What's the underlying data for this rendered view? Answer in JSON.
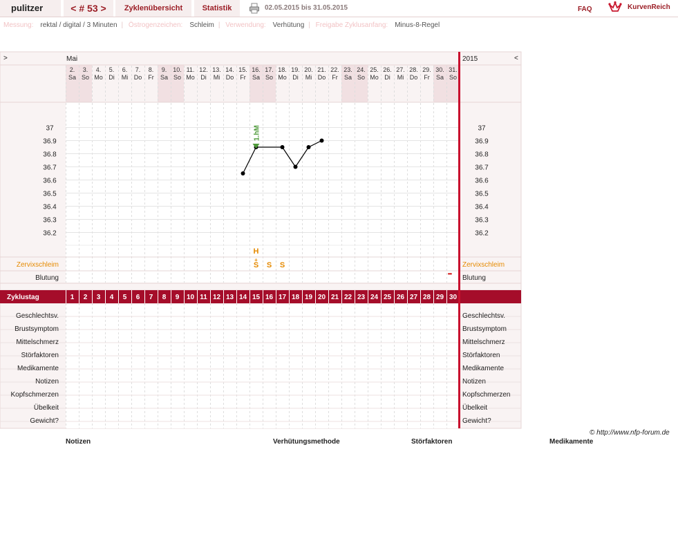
{
  "header": {
    "user": "pulitzer",
    "cycle_nav": "< # 53 >",
    "tab_overview": "Zyklenübersicht",
    "tab_stats": "Statistik",
    "date_range": "02.05.2015 bis 31.05.2015",
    "faq": "FAQ",
    "brand": "KurvenReich"
  },
  "settings": [
    {
      "label": "Messung:",
      "value": "rektal / digital / 3 Minuten"
    },
    {
      "label": "Östrogenzeichen:",
      "value": "Schleim"
    },
    {
      "label": "Verwendung:",
      "value": "Verhütung"
    },
    {
      "label": "Freigabe Zyklusanfang:",
      "value": "Minus-8-Regel"
    }
  ],
  "nav": {
    "left_arrow": ">",
    "right_arrow": "<",
    "month": "Mai",
    "year": "2015"
  },
  "chart_data": {
    "type": "line",
    "title": "",
    "dates": [
      "2.",
      "3.",
      "4.",
      "5.",
      "6.",
      "7.",
      "8.",
      "9.",
      "10.",
      "11.",
      "12.",
      "13.",
      "14.",
      "15.",
      "16.",
      "17.",
      "18.",
      "19.",
      "20.",
      "21.",
      "22.",
      "23.",
      "24.",
      "25.",
      "26.",
      "27.",
      "28.",
      "29.",
      "30.",
      "31."
    ],
    "weekdays": [
      "Sa",
      "So",
      "Mo",
      "Di",
      "Mi",
      "Do",
      "Fr",
      "Sa",
      "So",
      "Mo",
      "Di",
      "Mi",
      "Do",
      "Fr",
      "Sa",
      "So",
      "Mo",
      "Di",
      "Mi",
      "Do",
      "Fr",
      "Sa",
      "So",
      "Mo",
      "Di",
      "Mi",
      "Do",
      "Fr",
      "Sa",
      "So"
    ],
    "weekend_days": [
      1,
      2,
      8,
      9,
      15,
      16,
      22,
      23,
      29,
      30
    ],
    "cycle_days": [
      1,
      2,
      3,
      4,
      5,
      6,
      7,
      8,
      9,
      10,
      11,
      12,
      13,
      14,
      15,
      16,
      17,
      18,
      19,
      20,
      21,
      22,
      23,
      24,
      25,
      26,
      27,
      28,
      29,
      30
    ],
    "y_ticks": [
      "37",
      "36.9",
      "36.8",
      "36.7",
      "36.6",
      "36.5",
      "36.4",
      "36.3",
      "36.2"
    ],
    "ylim": [
      36.1,
      37.0
    ],
    "series": [
      {
        "points": [
          [
            14,
            36.65
          ],
          [
            15,
            36.85
          ],
          [
            17,
            36.85
          ],
          [
            18,
            36.7
          ],
          [
            19,
            36.85
          ],
          [
            20,
            36.9
          ]
        ]
      }
    ],
    "marker": {
      "day": 15,
      "label": "1.hM",
      "color": "#4e9a3a"
    },
    "mucus": [
      {
        "day": 15,
        "top": "H",
        "mid": "+",
        "sym": "S"
      },
      {
        "day": 16,
        "top": "",
        "mid": "",
        "sym": "S"
      },
      {
        "day": 17,
        "top": "",
        "mid": "",
        "sym": "S"
      }
    ],
    "bleeding_mark": {
      "day": 30,
      "text": "•••"
    }
  },
  "rows": {
    "cervix": "Zervixschleim",
    "bleeding": "Blutung",
    "cycle_day": "Zyklustag",
    "extra": [
      "Geschlechtsv.",
      "Brustsymptom",
      "Mittelschmerz",
      "Störfaktoren",
      "Medikamente",
      "Notizen",
      "Kopfschmerzen",
      "Übelkeit",
      "Gewicht?"
    ]
  },
  "copyright": "© http://www.nfp-forum.de",
  "footer": [
    "Notizen",
    "Verhütungsmethode",
    "Störfaktoren",
    "Medikamente"
  ],
  "colors": {
    "brand": "#9b1d25",
    "zyklustag_bar": "#a50d2a",
    "orange": "#e58a00",
    "weekend": "#f1e0e2",
    "pink_bg": "#f9f3f3"
  }
}
